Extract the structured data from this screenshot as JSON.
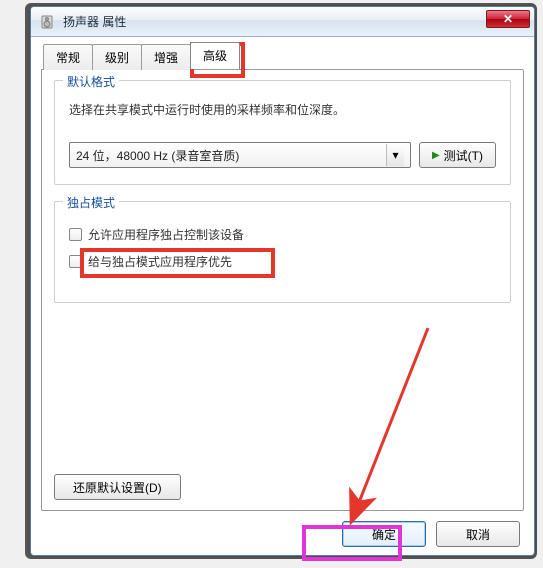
{
  "window": {
    "title": "扬声器 属性"
  },
  "tabs": {
    "items": [
      {
        "label": "常规"
      },
      {
        "label": "级别"
      },
      {
        "label": "增强"
      },
      {
        "label": "高级"
      }
    ],
    "active_index": 3
  },
  "default_format": {
    "group_title": "默认格式",
    "description": "选择在共享模式中运行时使用的采样频率和位深度。",
    "selected_option": "24 位，48000 Hz (录音室音质)",
    "test_button": "测试(T)"
  },
  "exclusive": {
    "group_title": "独占模式",
    "chk_allow": "允许应用程序独占控制该设备",
    "chk_priority": "给与独占模式应用程序优先"
  },
  "restore_button": "还原默认设置(D)",
  "footer": {
    "ok": "确定",
    "cancel": "取消"
  },
  "colors": {
    "highlight_red": "#e3372c",
    "highlight_pink": "#e036d8"
  }
}
